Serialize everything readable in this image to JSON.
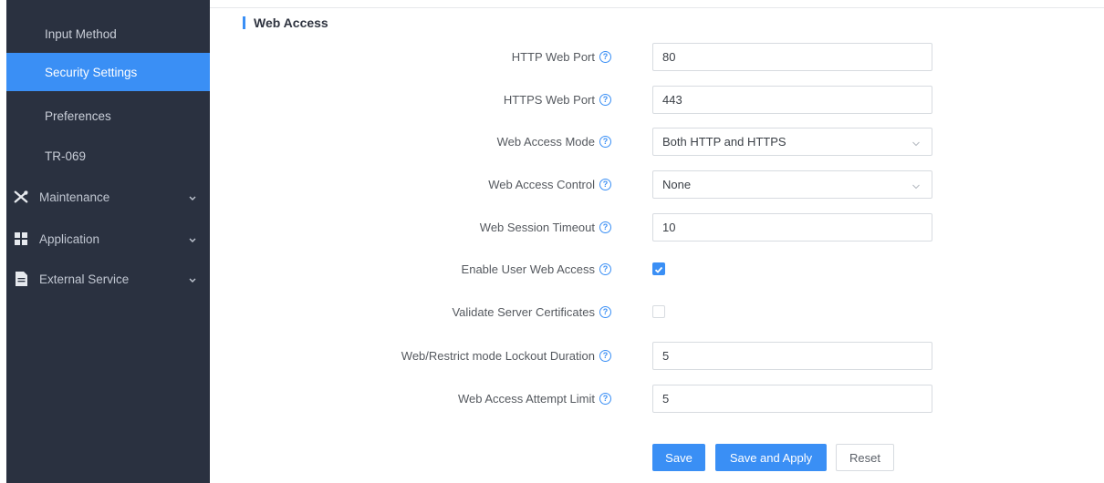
{
  "sidebar": {
    "items": [
      {
        "label": "Input Method"
      },
      {
        "label": "Security Settings"
      },
      {
        "label": "Preferences"
      },
      {
        "label": "TR-069"
      }
    ],
    "groups": [
      {
        "label": "Maintenance",
        "icon": "wrench-screwdriver-icon"
      },
      {
        "label": "Application",
        "icon": "grid-icon"
      },
      {
        "label": "External Service",
        "icon": "document-icon"
      }
    ],
    "active_item": "Security Settings"
  },
  "section": {
    "title": "Web Access"
  },
  "form": {
    "http_port": {
      "label": "HTTP Web Port",
      "value": "80"
    },
    "https_port": {
      "label": "HTTPS Web Port",
      "value": "443"
    },
    "access_mode": {
      "label": "Web Access Mode",
      "value": "Both HTTP and HTTPS"
    },
    "access_control": {
      "label": "Web Access Control",
      "value": "None"
    },
    "session_timeout": {
      "label": "Web Session Timeout",
      "value": "10"
    },
    "user_web_access": {
      "label": "Enable User Web Access",
      "checked": true
    },
    "validate_certs": {
      "label": "Validate Server Certificates",
      "checked": false
    },
    "lockout_duration": {
      "label": "Web/Restrict mode Lockout Duration",
      "value": "5"
    },
    "attempt_limit": {
      "label": "Web Access Attempt Limit",
      "value": "5"
    }
  },
  "buttons": {
    "save": "Save",
    "save_apply": "Save and Apply",
    "reset": "Reset"
  },
  "colors": {
    "accent": "#3a8ff5",
    "sidebar_bg": "#2a3140"
  }
}
